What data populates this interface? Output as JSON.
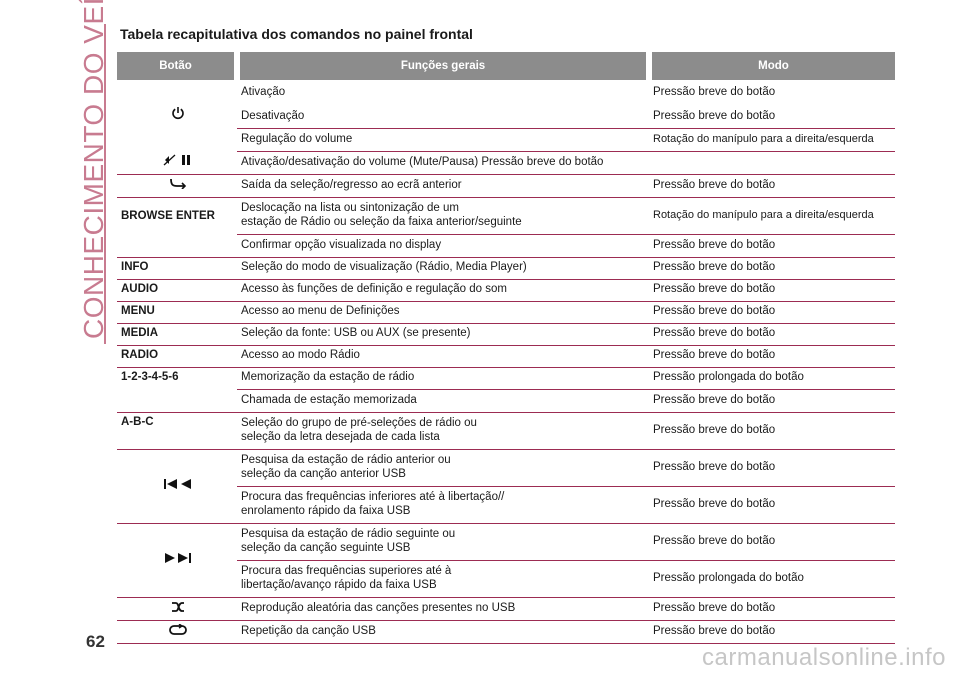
{
  "side_title": "CONHECIMENTO DO VEÍCULO",
  "page_number": "62",
  "watermark": "carmanualsonline.info",
  "heading": "Tabela recapitulativa dos comandos no painel frontal",
  "table": {
    "headers": [
      "Botão",
      "Funções gerais",
      "Modo"
    ],
    "rows": [
      {
        "button": "",
        "icon": "power-icon",
        "function": "Ativação",
        "mode": "Pressão breve do botão"
      },
      {
        "button": "",
        "icon": "",
        "function": "Desativação",
        "mode": "Pressão breve do botão"
      },
      {
        "button": "",
        "icon": "",
        "function": "Regulação do volume",
        "mode": "Rotação do manípulo para a direita/esquerda"
      },
      {
        "button": "",
        "icon": "mute-pause-icon",
        "function": "Ativação/desativação do volume (Mute/Pausa) Pressão breve do botão",
        "mode": ""
      },
      {
        "button": "",
        "icon": "back-icon",
        "function": "Saída da seleção/regresso ao ecrã anterior",
        "mode": "Pressão breve do botão"
      },
      {
        "button": "BROWSE ENTER",
        "icon": "",
        "function": "Deslocação na lista ou sintonização de um\nestação de Rádio ou seleção da faixa anterior/seguinte",
        "mode": "Rotação do manípulo para a direita/esquerda"
      },
      {
        "button": "",
        "icon": "",
        "function": "Confirmar opção visualizada no display",
        "mode": "Pressão breve do botão"
      },
      {
        "button": "INFO",
        "icon": "",
        "function": "Seleção do modo de visualização (Rádio, Media Player)",
        "mode": "Pressão breve do botão"
      },
      {
        "button": "AUDIO",
        "icon": "",
        "function": "Acesso às funções de definição e regulação do som",
        "mode": "Pressão breve do botão"
      },
      {
        "button": "MENU",
        "icon": "",
        "function": "Acesso ao menu de Definições",
        "mode": "Pressão breve do botão"
      },
      {
        "button": "MEDIA",
        "icon": "",
        "function": "Seleção da fonte: USB ou AUX (se presente)",
        "mode": "Pressão breve do botão"
      },
      {
        "button": "RADIO",
        "icon": "",
        "function": "Acesso ao modo Rádio",
        "mode": "Pressão breve do botão"
      },
      {
        "button": "1-2-3-4-5-6",
        "icon": "",
        "function": "Memorização da estação de rádio",
        "mode": "Pressão prolongada do botão"
      },
      {
        "button": "",
        "icon": "",
        "function": "Chamada de estação memorizada",
        "mode": "Pressão breve do botão"
      },
      {
        "button": "A-B-C",
        "icon": "",
        "function": "Seleção do grupo de pré-seleções de rádio ou\nseleção da letra desejada de cada lista",
        "mode": "Pressão breve do botão"
      },
      {
        "button": "",
        "icon": "previous-track-icon",
        "function": "Pesquisa da estação de rádio anterior ou\nseleção da canção anterior USB",
        "mode": "Pressão breve do botão"
      },
      {
        "button": "",
        "icon": "",
        "function": "Procura das frequências inferiores até à libertação//\nenrolamento rápido da faixa USB",
        "mode": "Pressão breve do botão"
      },
      {
        "button": "",
        "icon": "next-track-icon",
        "function": "Pesquisa da estação de rádio seguinte ou\nseleção da canção seguinte USB",
        "mode": "Pressão breve do botão"
      },
      {
        "button": "",
        "icon": "",
        "function": "Procura das frequências superiores até à\nlibertação/avanço rápido da faixa USB",
        "mode": "Pressão prolongada do botão"
      },
      {
        "button": "",
        "icon": "shuffle-icon",
        "function": "Reprodução aleatória das canções presentes no USB",
        "mode": "Pressão breve do botão"
      },
      {
        "button": "",
        "icon": "repeat-icon",
        "function": "Repetição da canção USB",
        "mode": "Pressão breve do botão"
      }
    ]
  }
}
